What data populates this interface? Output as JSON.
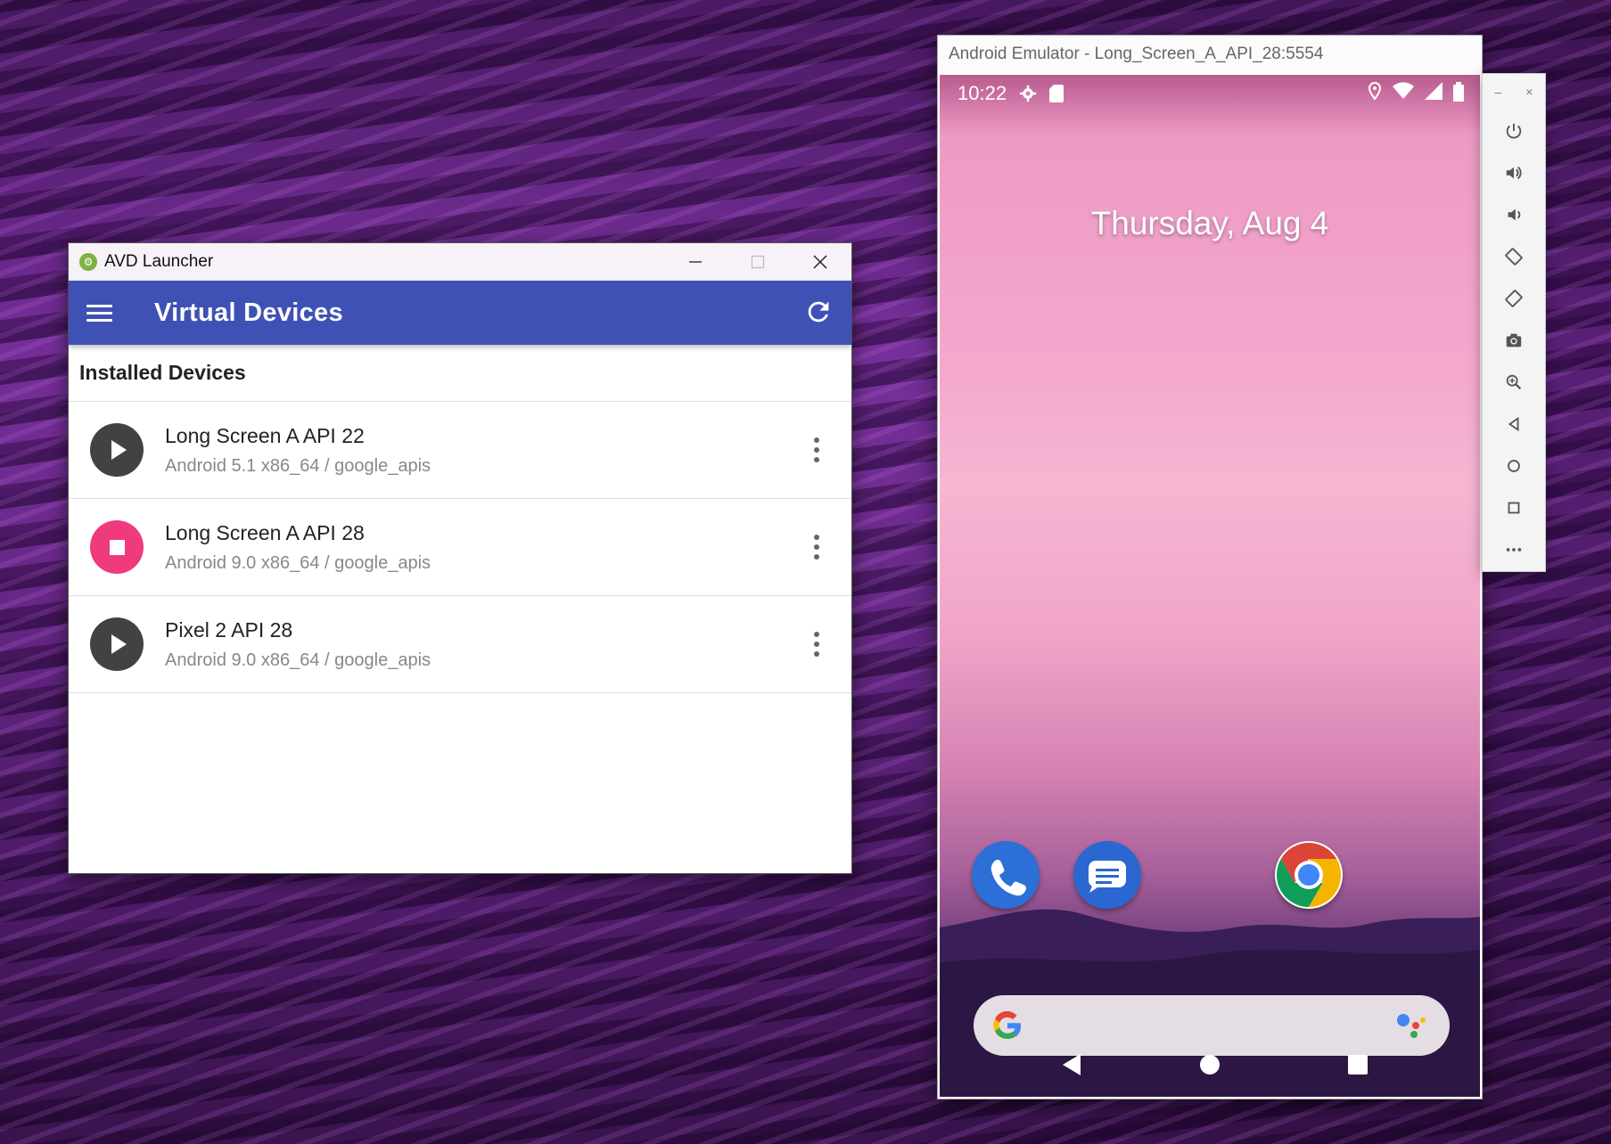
{
  "avd": {
    "window_title": "AVD Launcher",
    "appbar_title": "Virtual Devices",
    "section_title": "Installed Devices",
    "devices": [
      {
        "name": "Long Screen A API 22",
        "detail": "Android 5.1 x86_64 / google_apis",
        "state": "stopped"
      },
      {
        "name": "Long Screen A API 28",
        "detail": "Android 9.0 x86_64 / google_apis",
        "state": "running"
      },
      {
        "name": "Pixel 2 API 28",
        "detail": "Android 9.0 x86_64 / google_apis",
        "state": "stopped"
      }
    ],
    "accent_color": "#3f51b5",
    "running_color": "#ef3a7e"
  },
  "emulator": {
    "window_title": "Android Emulator - Long_Screen_A_API_28:5554",
    "status_time": "10:22",
    "date": "Thursday, Aug 4",
    "dock_apps": [
      "phone-icon",
      "messages-icon",
      "chrome-icon"
    ],
    "toolbar": [
      "power-icon",
      "volume-up-icon",
      "volume-down-icon",
      "rotate-left-icon",
      "rotate-right-icon",
      "camera-icon",
      "zoom-icon",
      "back-icon",
      "home-icon",
      "overview-icon",
      "more-icon"
    ]
  }
}
